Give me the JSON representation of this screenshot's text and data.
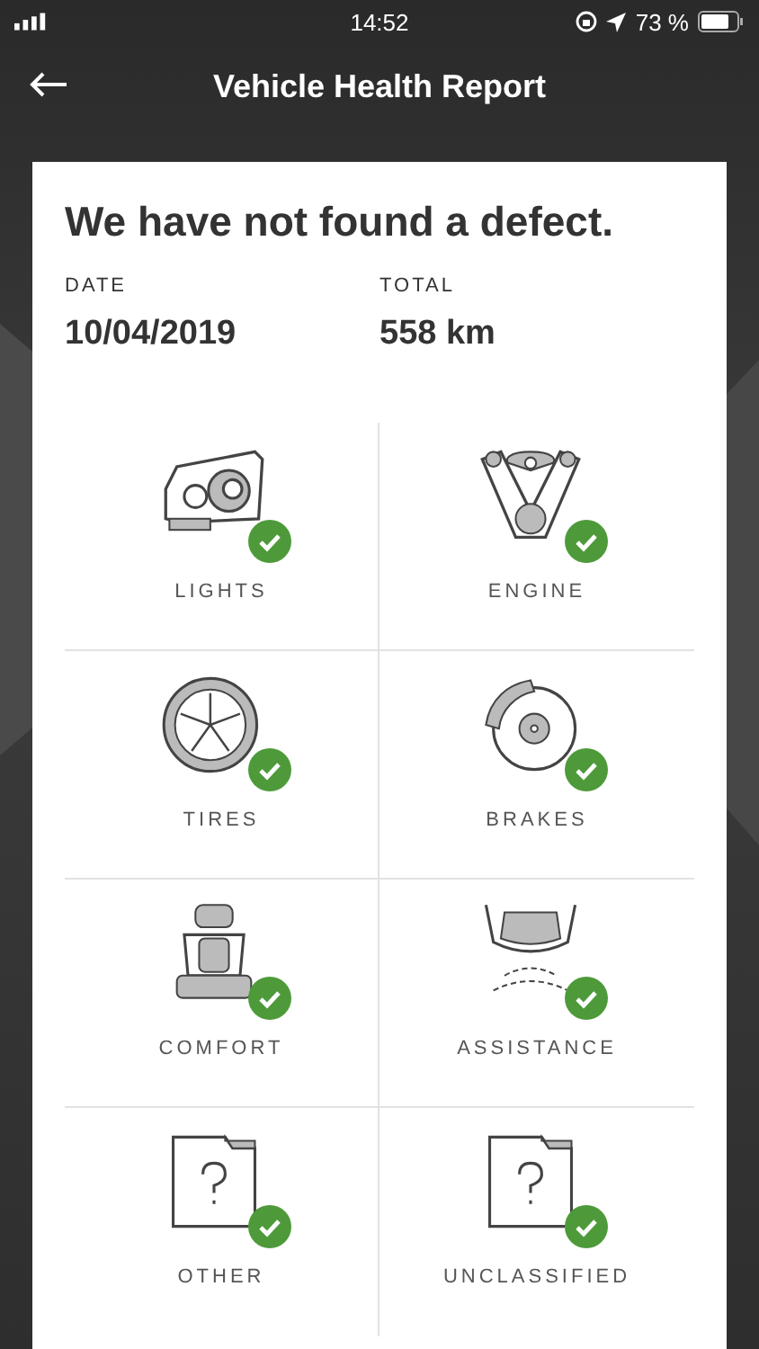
{
  "status_bar": {
    "time": "14:52",
    "battery": "73 %"
  },
  "header": {
    "title": "Vehicle Health Report"
  },
  "report": {
    "headline": "We have not found a defect.",
    "date_label": "DATE",
    "date": "10/04/2019",
    "total_label": "TOTAL",
    "total": "558 km"
  },
  "categories": [
    {
      "kind": "lights",
      "label": "LIGHTS",
      "ok": true
    },
    {
      "kind": "engine",
      "label": "ENGINE",
      "ok": true
    },
    {
      "kind": "tires",
      "label": "TIRES",
      "ok": true
    },
    {
      "kind": "brakes",
      "label": "BRAKES",
      "ok": true
    },
    {
      "kind": "comfort",
      "label": "COMFORT",
      "ok": true
    },
    {
      "kind": "assistance",
      "label": "ASSISTANCE",
      "ok": true
    },
    {
      "kind": "folder",
      "label": "OTHER",
      "ok": true
    },
    {
      "kind": "folder",
      "label": "UNCLASSIFIED",
      "ok": true
    }
  ]
}
